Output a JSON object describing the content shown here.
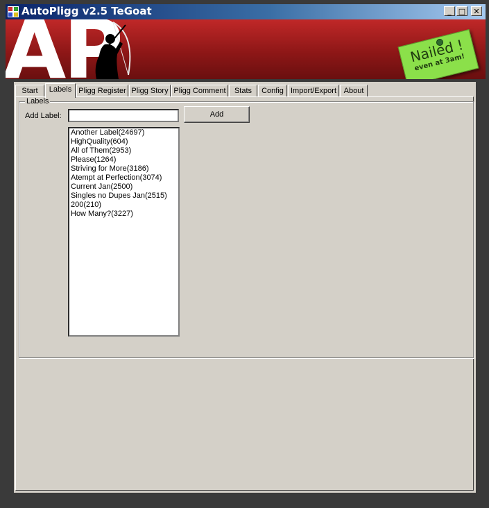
{
  "window": {
    "title": "AutoPligg v2.5 TeGoat",
    "minimize_glyph": "_",
    "maximize_glyph": "□",
    "close_glyph": "✕"
  },
  "banner": {
    "logo_text": "AP",
    "note_line1": "Nailed !",
    "note_line2": "even at 3am!",
    "colors": {
      "banner_red": "#8e1717",
      "note_green": "#8be04a"
    }
  },
  "tabs": [
    {
      "label": "Start"
    },
    {
      "label": "Labels"
    },
    {
      "label": "Pligg Register"
    },
    {
      "label": "Pligg Story"
    },
    {
      "label": "Pligg Comment"
    },
    {
      "label": "Stats"
    },
    {
      "label": "Config"
    },
    {
      "label": "Import/Export"
    },
    {
      "label": "About"
    }
  ],
  "active_tab": "Labels",
  "labels_page": {
    "group_title": "Labels",
    "add_label_caption": "Add Label:",
    "add_label_value": "",
    "add_button": "Add",
    "items": [
      "Another Label(24697)",
      "HighQuality(604)",
      "All of Them(2953)",
      "Please(1264)",
      "Striving for More(3186)",
      "Atempt at Perfection(3074)",
      "Current Jan(2500)",
      "Singles no Dupes Jan(2515)",
      "200(210)",
      "How Many?(3227)"
    ]
  }
}
